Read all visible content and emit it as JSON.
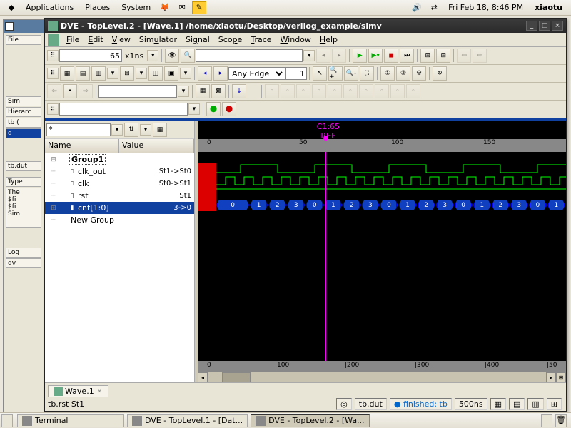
{
  "gnome": {
    "menus": [
      "Applications",
      "Places",
      "System"
    ],
    "clock": "Fri Feb 18,  8:46 PM",
    "user": "xiaotu"
  },
  "back_window": {
    "file_menu": "File",
    "sim_label": "Sim",
    "hier_label": "Hierarc",
    "tree_items": [
      "tb (",
      "d"
    ],
    "path": "tb.dut",
    "type_label": "Type",
    "text_block": "The\n$fi\n$fi\nSim",
    "log_tab": "Log",
    "dv_tab": "dv"
  },
  "dve": {
    "title": "DVE - TopLevel.2 - [Wave.1]  /home/xiaotu/Desktop/verilog_example/simv",
    "menus": [
      "File",
      "Edit",
      "View",
      "Simulator",
      "Signal",
      "Scope",
      "Trace",
      "Window",
      "Help"
    ],
    "time_value": "65",
    "time_unit": "x1ns",
    "edge_sel": "Any Edge",
    "edge_count": "1",
    "sig_filter": "*",
    "col_name": "Name",
    "col_value": "Value",
    "signals": [
      {
        "name": "Group1",
        "value": "",
        "type": "group",
        "indent": 0
      },
      {
        "name": "clk_out",
        "value": "St1->St0",
        "type": "clock",
        "indent": 1
      },
      {
        "name": "clk",
        "value": "St0->St1",
        "type": "clock",
        "indent": 1
      },
      {
        "name": "rst",
        "value": "St1",
        "type": "wire",
        "indent": 1
      },
      {
        "name": "cnt[1:0]",
        "value": "3->0",
        "type": "bus",
        "indent": 1,
        "selected": true
      },
      {
        "name": "New Group",
        "value": "",
        "type": "newgroup",
        "indent": 0
      }
    ],
    "cursor_label": "C1:65",
    "cursor_ref": "REF",
    "ruler_ticks": [
      {
        "pos": 0,
        "label": "0"
      },
      {
        "pos": 129,
        "label": "50"
      },
      {
        "pos": 258,
        "label": "100"
      },
      {
        "pos": 387,
        "label": "150"
      }
    ],
    "bot_ruler_ticks": [
      {
        "pos": 0,
        "label": "0"
      },
      {
        "pos": 98,
        "label": "100"
      },
      {
        "pos": 196,
        "label": "200"
      },
      {
        "pos": 294,
        "label": "300"
      },
      {
        "pos": 392,
        "label": "400"
      },
      {
        "pos": 479,
        "label": "50"
      }
    ],
    "bus_values": [
      "0",
      "1",
      "2",
      "3",
      "0",
      "1",
      "2",
      "3",
      "0",
      "1",
      "2",
      "3",
      "0",
      "1",
      "2",
      "3",
      "0",
      "1"
    ],
    "tab_label": "Wave.1",
    "status_left": "tb.rst St1",
    "status_scope": "tb.dut",
    "status_state": "finished: tb",
    "status_time": "500ns"
  },
  "taskbar": {
    "tasks": [
      {
        "label": "Terminal",
        "active": false
      },
      {
        "label": "DVE - TopLevel.1 - [Dat...",
        "active": false
      },
      {
        "label": "DVE - TopLevel.2 - [Wa...",
        "active": true
      }
    ]
  }
}
